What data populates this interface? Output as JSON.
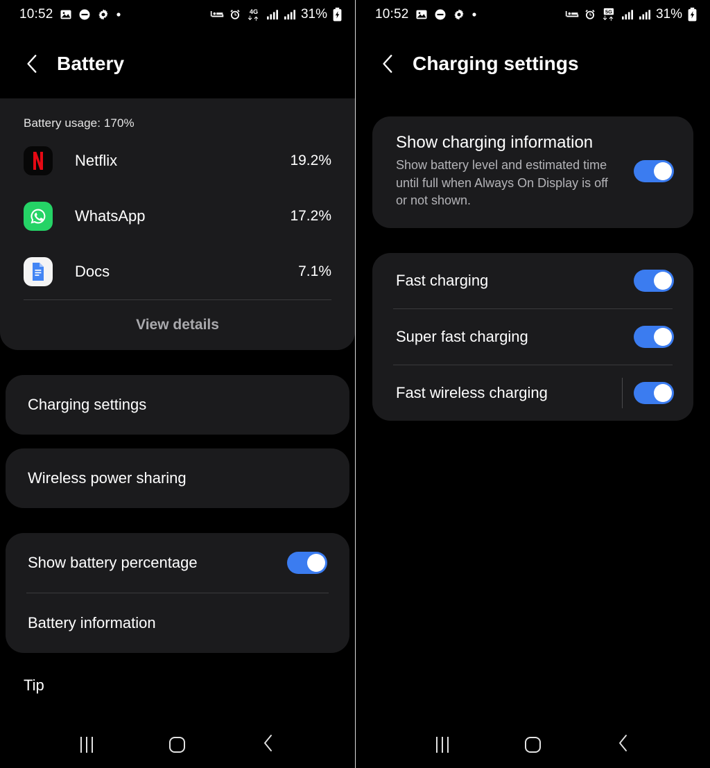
{
  "left": {
    "status_bar": {
      "time": "10:52",
      "left_icons": [
        "image-icon",
        "do-not-disturb-icon",
        "gear-icon",
        "dot-icon"
      ],
      "network": "4G",
      "right_icons": [
        "bed-icon",
        "alarm-icon",
        "network-4g-icon",
        "signal-bars-icon",
        "signal-bars-icon"
      ],
      "battery_percent": "31%",
      "battery_state": "charging"
    },
    "header": {
      "title": "Battery",
      "back_icon": "chevron-left-icon"
    },
    "usage": {
      "label": "Battery usage: 170%",
      "apps": [
        {
          "name": "Netflix",
          "percent": "19.2%",
          "icon": "netflix-icon"
        },
        {
          "name": "WhatsApp",
          "percent": "17.2%",
          "icon": "whatsapp-icon"
        },
        {
          "name": "Docs",
          "percent": "7.1%",
          "icon": "google-docs-icon"
        }
      ],
      "view_details": "View details"
    },
    "menu": [
      {
        "label": "Charging settings"
      },
      {
        "label": "Wireless power sharing"
      }
    ],
    "settings": {
      "show_battery_percentage": {
        "label": "Show battery percentage",
        "on": true
      },
      "battery_information": {
        "label": "Battery information"
      }
    },
    "tip": {
      "label": "Tip"
    },
    "navbar": {
      "recents": "recents-icon",
      "home": "home-icon",
      "back": "back-icon"
    }
  },
  "right": {
    "status_bar": {
      "time": "10:52",
      "left_icons": [
        "image-icon",
        "do-not-disturb-icon",
        "gear-icon",
        "dot-icon"
      ],
      "network": "5G",
      "right_icons": [
        "bed-icon",
        "alarm-icon",
        "network-5g-icon",
        "signal-bars-icon",
        "signal-bars-icon"
      ],
      "battery_percent": "31%",
      "battery_state": "charging"
    },
    "header": {
      "title": "Charging settings",
      "back_icon": "chevron-left-icon"
    },
    "charging_info": {
      "title": "Show charging information",
      "description": "Show battery level and estimated time until full when Always On Display is off or not shown.",
      "on": true
    },
    "toggles": [
      {
        "label": "Fast charging",
        "on": true
      },
      {
        "label": "Super fast charging",
        "on": true
      },
      {
        "label": "Fast wireless charging",
        "on": true
      }
    ],
    "navbar": {
      "recents": "recents-icon",
      "home": "home-icon",
      "back": "back-icon"
    }
  },
  "colors": {
    "accent_blue": "#3b7cf0",
    "card_bg": "#1b1b1d",
    "page_bg": "#000000",
    "netflix_red": "#e50914",
    "whatsapp_green": "#25d366",
    "docs_blue": "#4285f4"
  }
}
